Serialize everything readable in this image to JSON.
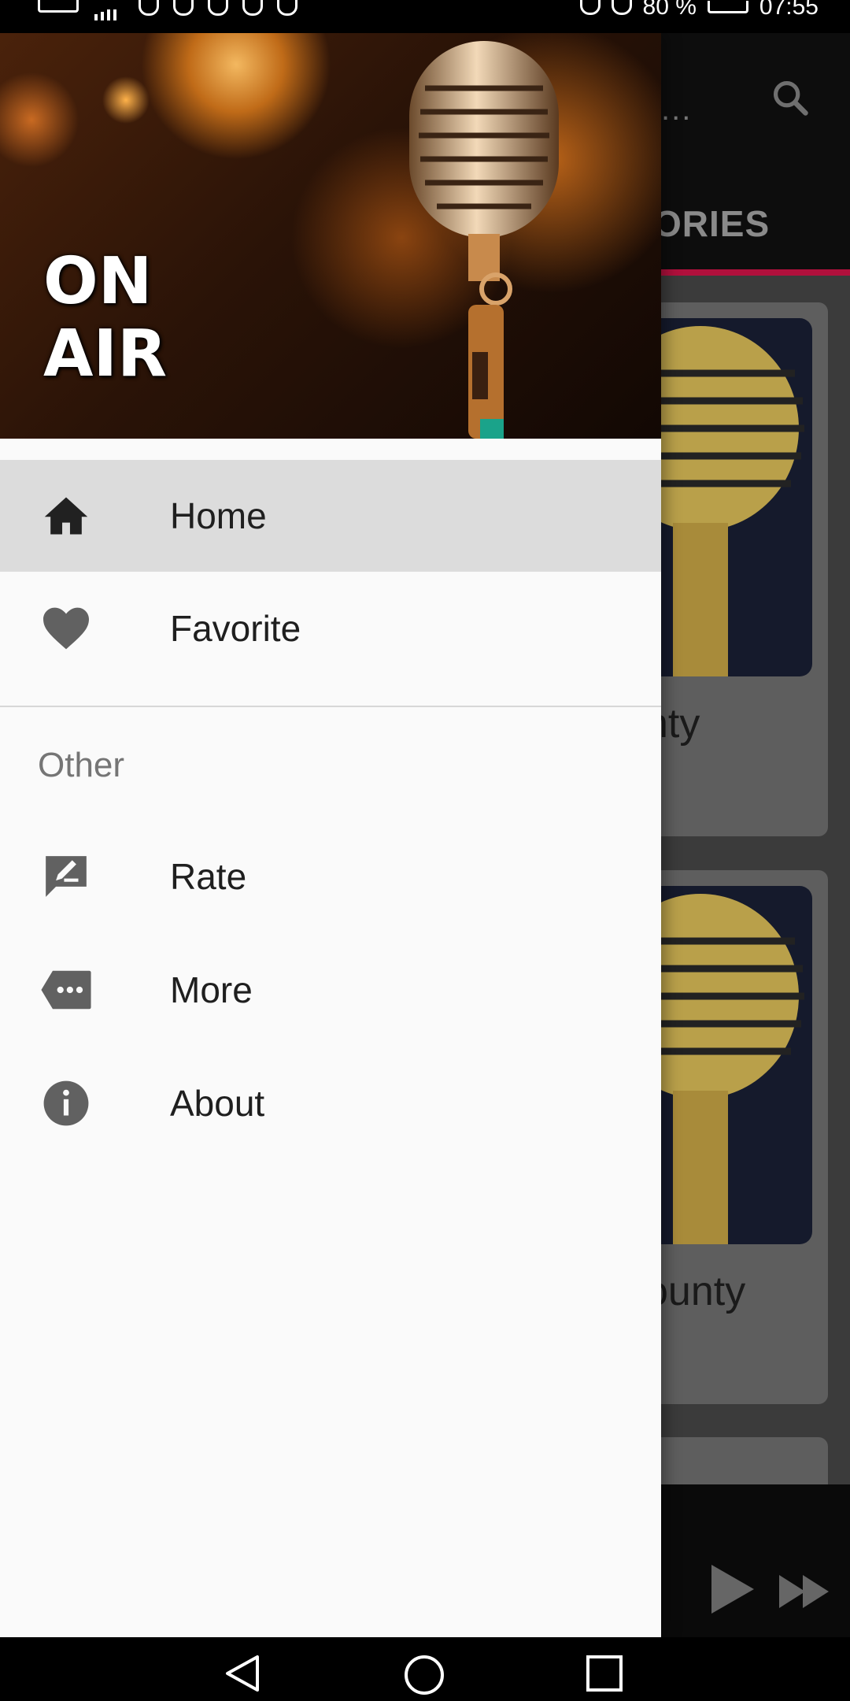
{
  "status_bar": {
    "left_label": "VoWiFi",
    "battery": "80 %",
    "time": "07:55"
  },
  "drawer": {
    "header_text_line1": "ON",
    "header_text_line2": "AIR",
    "items": [
      {
        "label": "Home",
        "icon": "home-icon",
        "active": true
      },
      {
        "label": "Favorite",
        "icon": "heart-icon",
        "active": false
      }
    ],
    "section_title": "Other",
    "other_items": [
      {
        "label": "Rate",
        "icon": "rate-icon"
      },
      {
        "label": "More",
        "icon": "more-icon"
      },
      {
        "label": "About",
        "icon": "info-icon"
      }
    ]
  },
  "background": {
    "toolbar_title_partial": "...",
    "tab_partial": "ORIES",
    "card_labels": [
      "nty",
      "ounty"
    ]
  },
  "colors": {
    "accent": "#b0103c",
    "drawer_bg": "#fafafa",
    "active_item_bg": "#dcdcdc",
    "icon_gray": "#616161"
  }
}
